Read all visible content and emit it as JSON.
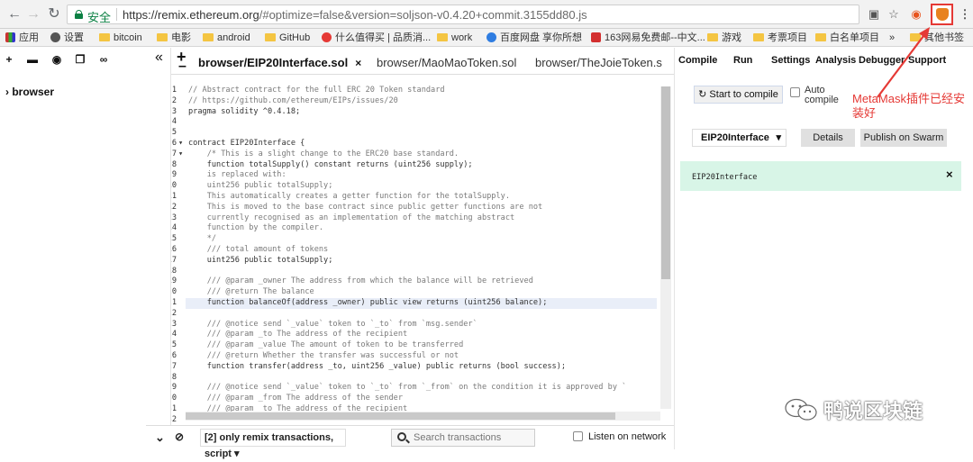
{
  "browser": {
    "secure_label": "安全",
    "url_origin": "https://remix.ethereum.org",
    "url_rest": "/#optimize=false&version=soljson-v0.4.20+commit.3155dd80.js"
  },
  "bookmarks": [
    {
      "label": "应用"
    },
    {
      "label": "设置"
    },
    {
      "label": "bitcoin"
    },
    {
      "label": "电影"
    },
    {
      "label": "android"
    },
    {
      "label": "GitHub"
    },
    {
      "label": "什么值得买 | 品质消..."
    },
    {
      "label": "work"
    },
    {
      "label": "百度网盘 享你所想"
    },
    {
      "label": "163网易免费邮--中文..."
    },
    {
      "label": "游戏"
    },
    {
      "label": "考票项目"
    },
    {
      "label": "白名单项目"
    },
    {
      "label": "»"
    },
    {
      "label": "其他书签"
    }
  ],
  "file_panel": {
    "root": "browser"
  },
  "file_tabs": [
    {
      "label": "browser/EIP20Interface.sol",
      "close": "×"
    },
    {
      "label": "browser/MaoMaoToken.sol"
    },
    {
      "label": "browser/TheJoieToken.s"
    }
  ],
  "editor": {
    "lines": [
      "// Abstract contract for the full ERC 20 Token standard",
      "// https://github.com/ethereum/EIPs/issues/20",
      "pragma solidity ^0.4.18;",
      "",
      "",
      "contract EIP20Interface {",
      "    /* This is a slight change to the ERC20 base standard.",
      "    function totalSupply() constant returns (uint256 supply);",
      "    is replaced with:",
      "    uint256 public totalSupply;",
      "    This automatically creates a getter function for the totalSupply.",
      "    This is moved to the base contract since public getter functions are not",
      "    currently recognised as an implementation of the matching abstract",
      "    function by the compiler.",
      "    */",
      "    /// total amount of tokens",
      "    uint256 public totalSupply;",
      "",
      "    /// @param _owner The address from which the balance will be retrieved",
      "    /// @return The balance",
      "    function balanceOf(address _owner) public view returns (uint256 balance);",
      "",
      "    /// @notice send `_value` token to `_to` from `msg.sender`",
      "    /// @param _to The address of the recipient",
      "    /// @param _value The amount of token to be transferred",
      "    /// @return Whether the transfer was successful or not",
      "    function transfer(address _to, uint256 _value) public returns (bool success);",
      "",
      "    /// @notice send `_value` token to `_to` from `_from` on the condition it is approved by `",
      "    /// @param _from The address of the sender",
      "    /// @param _to The address of the recipient",
      ""
    ]
  },
  "terminal": {
    "filter": "[2] only remix transactions, script",
    "search_placeholder": "Search transactions",
    "listen_label": "Listen on network"
  },
  "right_tabs": [
    {
      "label": "Compile"
    },
    {
      "label": "Run"
    },
    {
      "label": "Settings"
    },
    {
      "label": "Analysis"
    },
    {
      "label": "Debugger"
    },
    {
      "label": "Support"
    }
  ],
  "compile": {
    "start_label": "Start to compile",
    "auto_label": "Auto compile",
    "contract_selected": "EIP20Interface",
    "details_label": "Details",
    "swarm_label": "Publish on Swarm",
    "contract_name": "EIP20Interface"
  },
  "annotation": "MetaMask插件已经安装好",
  "watermark": "鸭说区块链",
  "colors": {
    "annotation": "#e53935",
    "secure": "#0b8043",
    "contract_box": "#d8f5e7"
  }
}
